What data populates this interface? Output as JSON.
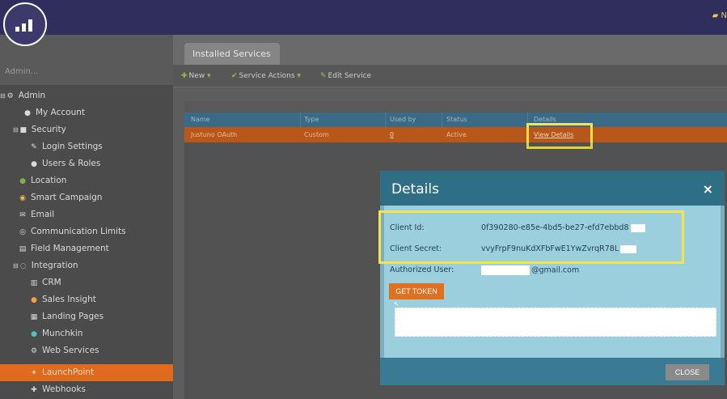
{
  "topbar": {
    "right_text": "N"
  },
  "sidebar": {
    "search_placeholder": "Admin...",
    "items": [
      {
        "label": "Admin",
        "icon": "gear-icon",
        "expand": "⊟"
      },
      {
        "label": "My Account",
        "icon": "person-icon"
      },
      {
        "label": "Security",
        "icon": "lock-icon",
        "expand": "⊟"
      },
      {
        "label": "Login Settings",
        "icon": "wrench-icon"
      },
      {
        "label": "Users & Roles",
        "icon": "users-icon"
      },
      {
        "label": "Location",
        "icon": "globe-icon"
      },
      {
        "label": "Smart Campaign",
        "icon": "bulb-icon"
      },
      {
        "label": "Email",
        "icon": "email-icon"
      },
      {
        "label": "Communication Limits",
        "icon": "limits-icon"
      },
      {
        "label": "Field Management",
        "icon": "field-icon"
      },
      {
        "label": "Integration",
        "icon": "integration-icon",
        "expand": "⊟"
      },
      {
        "label": "CRM",
        "icon": "crm-icon"
      },
      {
        "label": "Sales Insight",
        "icon": "insight-icon"
      },
      {
        "label": "Landing Pages",
        "icon": "pages-icon"
      },
      {
        "label": "Munchkin",
        "icon": "munchkin-icon"
      },
      {
        "label": "Web Services",
        "icon": "plug-icon"
      },
      {
        "label": "LaunchPoint",
        "icon": "launchpoint-icon"
      },
      {
        "label": "Webhooks",
        "icon": "webhook-icon"
      }
    ]
  },
  "tabs": {
    "active": "Installed Services"
  },
  "toolbar": {
    "new_label": "New",
    "actions_label": "Service Actions",
    "edit_label": "Edit Service"
  },
  "table": {
    "headers": [
      "Name",
      "Type",
      "Used by",
      "Status",
      "Details"
    ],
    "row": {
      "name": "Justuno OAuth",
      "type": "Custom",
      "used_by": "0",
      "status": "Active",
      "details": "View Details"
    }
  },
  "modal": {
    "title": "Details",
    "close_glyph": "×",
    "client_id_label": "Client Id:",
    "client_id_value": "0f390280-e85e-4bd5-be27-efd7ebbd8",
    "client_secret_label": "Client Secret:",
    "client_secret_value": "vvyFrpF9nuKdXFbFwE1YwZvrqR78L",
    "authorized_user_label": "Authorized User:",
    "authorized_user_value": "@gmail.com",
    "get_token_label": "GET TOKEN",
    "close_label": "CLOSE"
  },
  "colors": {
    "accent_orange": "#e06b1f",
    "modal_teal": "#2f6f86",
    "highlight_yellow": "#f6e34a"
  }
}
